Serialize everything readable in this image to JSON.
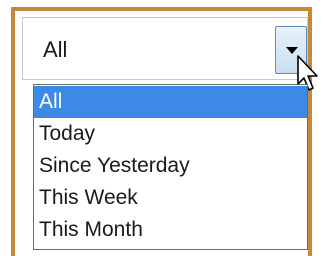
{
  "dropdown": {
    "selected_value": "All",
    "arrow_icon": "chevron-down-icon",
    "options": [
      "All",
      "Today",
      "Since Yesterday",
      "This Week",
      "This Month"
    ],
    "highlighted_index": 0
  },
  "colors": {
    "frame_border": "#c5893e",
    "highlight": "#3d89e6"
  }
}
